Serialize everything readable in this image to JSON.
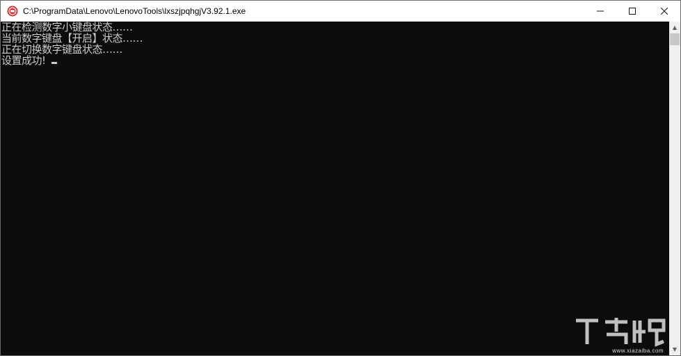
{
  "window": {
    "title": "C:\\ProgramData\\Lenovo\\LenovoTools\\lxszjpqhgjV3.92.1.exe",
    "minimize_glyph": "—",
    "maximize_glyph": "☐",
    "close_glyph": "✕"
  },
  "console": {
    "lines": [
      "正在检测数字小键盘状态……",
      "当前数字键盘【开启】状态……",
      "正在切换数字键盘状态……",
      "设置成功!"
    ]
  },
  "scrollbar": {
    "up_glyph": "▲",
    "down_glyph": "▼"
  },
  "watermark": {
    "url": "www.xiazaiba.com"
  },
  "colors": {
    "console_bg": "#0c0c0c",
    "console_text": "#cccccc",
    "titlebar_bg": "#ffffff",
    "icon_red": "#d32f2f"
  }
}
